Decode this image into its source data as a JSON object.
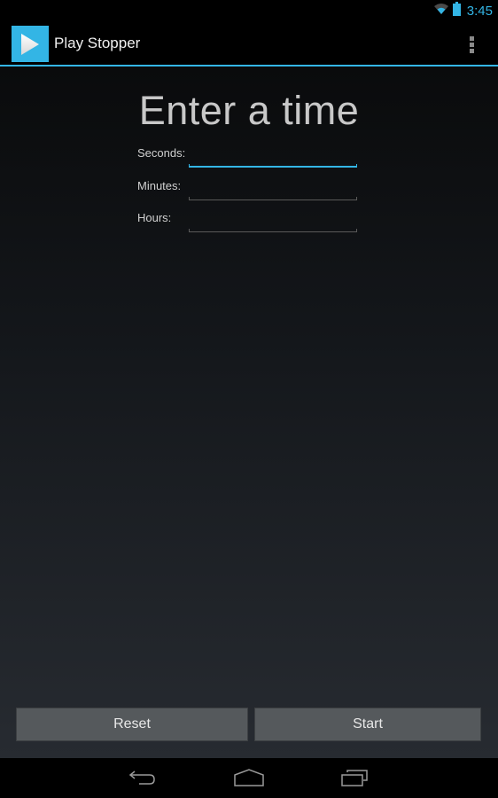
{
  "status_bar": {
    "time": "3:45",
    "icons": [
      "wifi-icon",
      "battery-icon"
    ],
    "accent_color": "#33b5e5"
  },
  "action_bar": {
    "app_icon": "play-icon",
    "title": "Play Stopper",
    "overflow_icon": "overflow-menu-icon"
  },
  "main": {
    "title": "Enter a time",
    "fields": [
      {
        "label": "Seconds:",
        "value": "",
        "placeholder": "",
        "focused": true
      },
      {
        "label": "Minutes:",
        "value": "",
        "placeholder": "",
        "focused": false
      },
      {
        "label": "Hours:",
        "value": "",
        "placeholder": "",
        "focused": false
      }
    ],
    "buttons": {
      "reset_label": "Reset",
      "start_label": "Start"
    }
  },
  "nav_bar": {
    "icons": [
      "back-icon",
      "home-icon",
      "recent-apps-icon"
    ]
  }
}
